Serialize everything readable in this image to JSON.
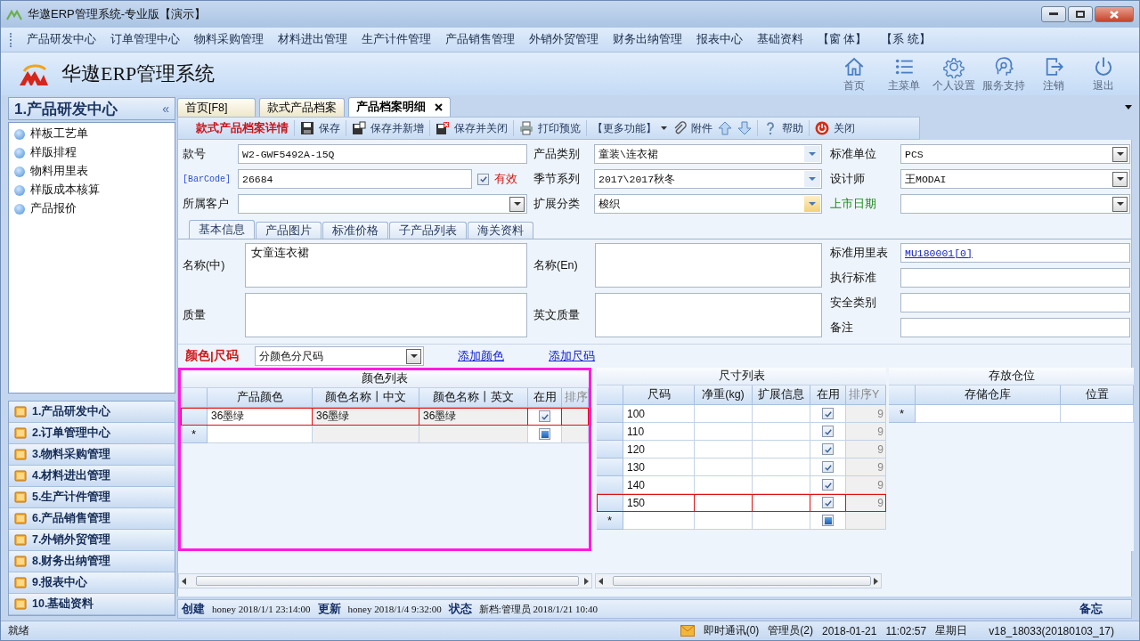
{
  "window": {
    "title": "华遨ERP管理系统-专业版【演示】"
  },
  "menu": [
    "产品研发中心",
    "订单管理中心",
    "物料采购管理",
    "材料进出管理",
    "生产计件管理",
    "产品销售管理",
    "外销外贸管理",
    "财务出纳管理",
    "报表中心",
    "基础资料",
    "【窗 体】",
    "【系 统】"
  ],
  "app_title": "华遨ERP管理系统",
  "header_buttons": [
    {
      "label": "首页",
      "kind": "home"
    },
    {
      "label": "主菜单",
      "kind": "list"
    },
    {
      "label": "个人设置",
      "kind": "gear"
    },
    {
      "label": "服务支持",
      "kind": "support"
    },
    {
      "label": "注销",
      "kind": "logout"
    },
    {
      "label": "退出",
      "kind": "power"
    }
  ],
  "sidebar": {
    "title": "1.产品研发中心",
    "collapse": "«",
    "items": [
      "样板工艺单",
      "样版排程",
      "物料用里表",
      "样版成本核算",
      "产品报价"
    ],
    "modules": [
      "1.产品研发中心",
      "2.订单管理中心",
      "3.物料采购管理",
      "4.材料进出管理",
      "5.生产计件管理",
      "6.产品销售管理",
      "7.外销外贸管理",
      "8.财务出纳管理",
      "9.报表中心",
      "10.基础资料"
    ]
  },
  "tabs": [
    {
      "label": "首页[F8]",
      "selected": false,
      "closable": false
    },
    {
      "label": "款式产品档案",
      "selected": false,
      "closable": false
    },
    {
      "label": "产品档案明细",
      "selected": true,
      "closable": true
    }
  ],
  "toolbar": [
    [
      {
        "kind": "title",
        "label": "款式产品档案详情"
      }
    ],
    [
      {
        "kind": "button",
        "label": "保存"
      }
    ],
    [
      {
        "kind": "button",
        "label": "保存并新增"
      }
    ],
    [
      {
        "kind": "button",
        "label": "保存并关闭"
      }
    ],
    [
      {
        "kind": "button",
        "label": "打印预览"
      }
    ],
    [
      {
        "kind": "menu",
        "label": "【更多功能】"
      },
      {
        "kind": "button",
        "label": "附件"
      },
      {
        "kind": "icon"
      },
      {
        "kind": "icon"
      }
    ],
    [
      {
        "kind": "button",
        "label": "帮助"
      }
    ],
    [
      {
        "kind": "button",
        "label": "关闭"
      }
    ]
  ],
  "form": [
    [
      {
        "label": "款号",
        "kind": "text",
        "value": "W2-GWF5492A-15Q"
      },
      {
        "label": "产品类别",
        "kind": "combo",
        "value": "童装\\连衣裙",
        "focused": false
      },
      {
        "label": "标准单位",
        "kind": "dropdown",
        "value": "PCS"
      }
    ],
    [
      {
        "label": "[BarCode]",
        "link": true,
        "kind": "text",
        "value": "26684",
        "checkbox": {
          "label": "有效",
          "checked": true
        }
      },
      {
        "label": "季节系列",
        "kind": "combo",
        "value": "2017\\2017秋冬",
        "focused": false
      },
      {
        "label": "设计师",
        "kind": "dropdown",
        "value": "王MODAI"
      }
    ],
    [
      {
        "label": "所属客户",
        "kind": "dropdown"
      },
      {
        "label": "扩展分类",
        "kind": "combo",
        "value": "梭织",
        "focused": true
      },
      {
        "label": "上市日期",
        "color": "#1a8a1a",
        "kind": "dropdown"
      }
    ]
  ],
  "subtabs": [
    {
      "label": "基本信息",
      "selected": true
    },
    {
      "label": "产品图片",
      "selected": false
    },
    {
      "label": "标准价格",
      "selected": false
    },
    {
      "label": "子产品列表",
      "selected": false
    },
    {
      "label": "海关资料",
      "selected": false
    }
  ],
  "basic_info": [
    [
      {
        "label": "名称(中)",
        "kind": "textarea",
        "value": "女童连衣裙"
      },
      {
        "label": "质量",
        "kind": "textarea"
      }
    ],
    [
      {
        "label": "名称(En)",
        "kind": "textarea"
      },
      {
        "label": "英文质量",
        "kind": "textarea"
      }
    ],
    [
      {
        "label": "标准用里表",
        "kind": "link",
        "value": "MU180001[0]"
      },
      {
        "label": "执行标准",
        "kind": "text"
      },
      {
        "label": "安全类别",
        "kind": "text"
      },
      {
        "label": "备注",
        "kind": "text"
      }
    ]
  ],
  "size_mode": {
    "label": "颜色|尺码",
    "value": "分颜色分尺码",
    "links": [
      "添加颜色",
      "添加尺码"
    ]
  },
  "color_grid": {
    "title": "颜色列表",
    "highlighted": true,
    "columns": [
      "产品颜色",
      "颜色名称丨中文",
      "颜色名称丨英文",
      "在用",
      "排序"
    ],
    "rows": [
      {
        "cells": [
          "36墨绿",
          "36墨绿",
          "36墨绿"
        ],
        "in_use": true,
        "selected": true
      }
    ],
    "new_row": {
      "marker": "*",
      "in_use_indeterminate": true
    }
  },
  "size_grid": {
    "title": "尺寸列表",
    "columns": [
      "尺码",
      "净重(kg)",
      "扩展信息",
      "在用",
      "排序Y"
    ],
    "rows": [
      {
        "size": "100",
        "in_use": true,
        "sort": "9",
        "selected": false
      },
      {
        "size": "110",
        "in_use": true,
        "sort": "9",
        "selected": false
      },
      {
        "size": "120",
        "in_use": true,
        "sort": "9",
        "selected": false
      },
      {
        "size": "130",
        "in_use": true,
        "sort": "9",
        "selected": false
      },
      {
        "size": "140",
        "in_use": true,
        "sort": "9",
        "selected": false
      },
      {
        "size": "150",
        "in_use": true,
        "sort": "9",
        "selected": true
      }
    ],
    "new_row": {
      "marker": "*",
      "in_use_indeterminate": true
    }
  },
  "warehouse_grid": {
    "title": "存放仓位",
    "columns": [
      "存储仓库",
      "位置"
    ],
    "new_row": {
      "marker": "*"
    }
  },
  "record_info": [
    {
      "label": "创建",
      "value": "honey 2018/1/1 23:14:00"
    },
    {
      "label": "更新",
      "value": "honey 2018/1/4 9:32:00"
    },
    {
      "label": "状态",
      "value": "新档:管理员 2018/1/21 10:40"
    }
  ],
  "memo": "备忘",
  "status_bar": {
    "status": "就绪",
    "messages": "即时通讯(0)",
    "user": "管理员(2)",
    "date": "2018-01-21",
    "time": "11:02:57",
    "weekday": "星期日",
    "version": "v18_18033(20180103_17)"
  }
}
